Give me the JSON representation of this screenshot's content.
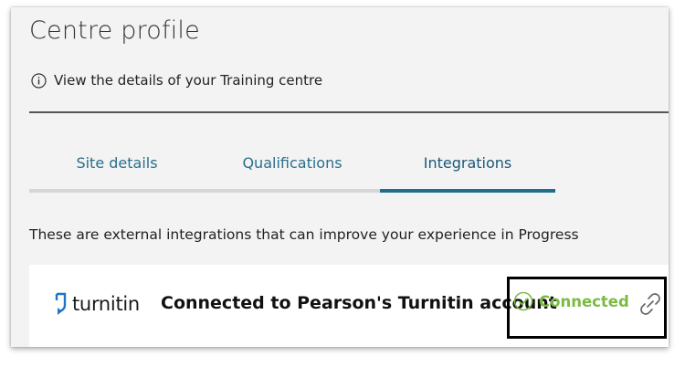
{
  "page": {
    "title": "Centre profile",
    "info_text": "View the details of your Training centre"
  },
  "tabs": [
    {
      "label": "Site details",
      "active": false
    },
    {
      "label": "Qualifications",
      "active": false
    },
    {
      "label": "Integrations",
      "active": true
    }
  ],
  "integrations": {
    "intro": "These are external integrations that can improve your experience in Progress",
    "items": [
      {
        "logo_text": "turnitin",
        "description": "Connected to Pearson's Turnitin account",
        "status": "Connected",
        "status_icon": "check-circle-icon",
        "action_icon": "unlink-icon"
      }
    ]
  },
  "colors": {
    "tab_text": "#2a6f8b",
    "tab_active_underline": "#1f6e8c",
    "status_connected": "#7cbb43",
    "turnitin_blue": "#1f74c9"
  }
}
